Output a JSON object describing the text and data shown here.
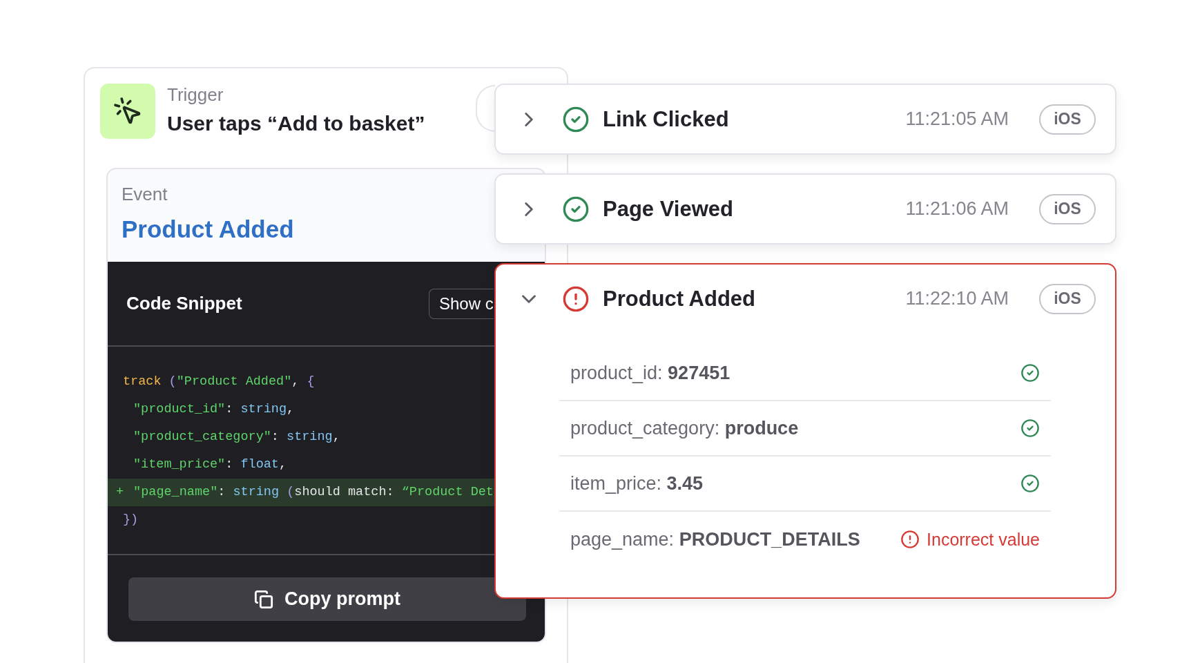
{
  "trigger": {
    "label": "Trigger",
    "title": "User taps “Add to basket”"
  },
  "event": {
    "label": "Event",
    "name": "Product Added"
  },
  "code_snippet": {
    "title": "Code Snippet",
    "button": "Show c",
    "lines": [
      {
        "added": false,
        "indented": false,
        "tokens": [
          {
            "kind": "function",
            "text": "track"
          },
          {
            "kind": "punct",
            "text": " ("
          },
          {
            "kind": "string",
            "text": "\"Product Added\""
          },
          {
            "kind": "plain",
            "text": ", "
          },
          {
            "kind": "punct",
            "text": "{"
          }
        ]
      },
      {
        "added": false,
        "indented": true,
        "tokens": [
          {
            "kind": "string",
            "text": "\"product_id\""
          },
          {
            "kind": "plain",
            "text": ": "
          },
          {
            "kind": "type",
            "text": "string"
          },
          {
            "kind": "plain",
            "text": ","
          }
        ]
      },
      {
        "added": false,
        "indented": true,
        "tokens": [
          {
            "kind": "string",
            "text": "\"product_category\""
          },
          {
            "kind": "plain",
            "text": ": "
          },
          {
            "kind": "type",
            "text": "string"
          },
          {
            "kind": "plain",
            "text": ","
          }
        ]
      },
      {
        "added": false,
        "indented": true,
        "tokens": [
          {
            "kind": "string",
            "text": "\"item_price\""
          },
          {
            "kind": "plain",
            "text": ": "
          },
          {
            "kind": "type",
            "text": "float"
          },
          {
            "kind": "plain",
            "text": ","
          }
        ]
      },
      {
        "added": true,
        "prefix": "+",
        "indented": true,
        "tokens": [
          {
            "kind": "string",
            "text": "\"page_name\""
          },
          {
            "kind": "plain",
            "text": ": "
          },
          {
            "kind": "type",
            "text": "string"
          },
          {
            "kind": "punct",
            "text": " ("
          },
          {
            "kind": "plain",
            "text": "should match: "
          },
          {
            "kind": "string",
            "text": "“Product Det"
          }
        ]
      },
      {
        "added": false,
        "indented": false,
        "tokens": [
          {
            "kind": "punct",
            "text": "})"
          }
        ]
      }
    ],
    "copy_button": "Copy prompt"
  },
  "events": [
    {
      "name": "Link Clicked",
      "time": "11:21:05 AM",
      "platform": "iOS",
      "ok": true,
      "expanded": false
    },
    {
      "name": "Page Viewed",
      "time": "11:21:06 AM",
      "platform": "iOS",
      "ok": true,
      "expanded": false
    },
    {
      "name": "Product Added",
      "time": "11:22:10 AM",
      "platform": "iOS",
      "ok": false,
      "expanded": true,
      "properties": [
        {
          "text": "product_id: **927451**",
          "valid": true
        },
        {
          "text": "product_category: **produce**",
          "valid": true
        },
        {
          "text": "item_price: **3.45**",
          "valid": true
        },
        {
          "text": "page_name: **PRODUCT_DETAILS**",
          "valid": false,
          "message": "Incorrect value"
        }
      ]
    }
  ]
}
